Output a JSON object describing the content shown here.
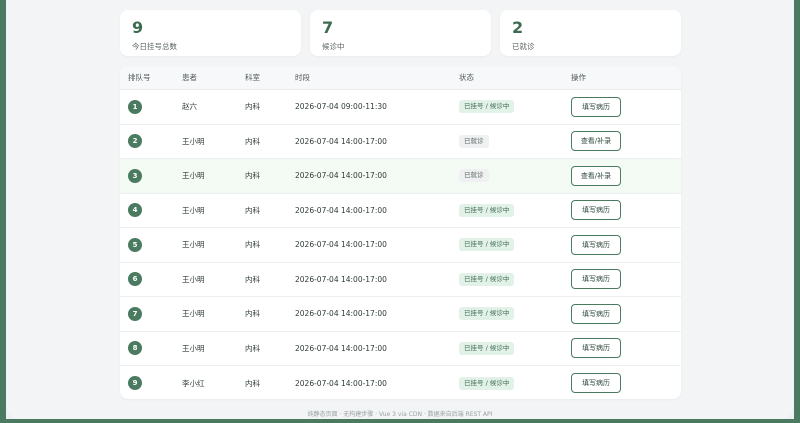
{
  "stats": [
    {
      "value": "9",
      "label": "今日挂号总数"
    },
    {
      "value": "7",
      "label": "候诊中"
    },
    {
      "value": "2",
      "label": "已就诊"
    }
  ],
  "table": {
    "headers": [
      "排队号",
      "患者",
      "科室",
      "时段",
      "状态",
      "操作"
    ],
    "rows": [
      {
        "queue": "1",
        "patient": "赵六",
        "dept": "内科",
        "time": "2026-07-04 09:00-11:30",
        "status": "已挂号 / 候诊中",
        "status_type": "waiting",
        "action": "填写病历"
      },
      {
        "queue": "2",
        "patient": "王小明",
        "dept": "内科",
        "time": "2026-07-04 14:00-17:00",
        "status": "已就诊",
        "status_type": "done",
        "action": "查看/补录"
      },
      {
        "queue": "3",
        "patient": "王小明",
        "dept": "内科",
        "time": "2026-07-04 14:00-17:00",
        "status": "已就诊",
        "status_type": "done",
        "action": "查看/补录"
      },
      {
        "queue": "4",
        "patient": "王小明",
        "dept": "内科",
        "time": "2026-07-04 14:00-17:00",
        "status": "已挂号 / 候诊中",
        "status_type": "waiting",
        "action": "填写病历"
      },
      {
        "queue": "5",
        "patient": "王小明",
        "dept": "内科",
        "time": "2026-07-04 14:00-17:00",
        "status": "已挂号 / 候诊中",
        "status_type": "waiting",
        "action": "填写病历"
      },
      {
        "queue": "6",
        "patient": "王小明",
        "dept": "内科",
        "time": "2026-07-04 14:00-17:00",
        "status": "已挂号 / 候诊中",
        "status_type": "waiting",
        "action": "填写病历"
      },
      {
        "queue": "7",
        "patient": "王小明",
        "dept": "内科",
        "time": "2026-07-04 14:00-17:00",
        "status": "已挂号 / 候诊中",
        "status_type": "waiting",
        "action": "填写病历"
      },
      {
        "queue": "8",
        "patient": "王小明",
        "dept": "内科",
        "time": "2026-07-04 14:00-17:00",
        "status": "已挂号 / 候诊中",
        "status_type": "waiting",
        "action": "填写病历"
      },
      {
        "queue": "9",
        "patient": "李小红",
        "dept": "内科",
        "time": "2026-07-04 14:00-17:00",
        "status": "已挂号 / 候诊中",
        "status_type": "waiting",
        "action": "填写病历"
      }
    ]
  },
  "footer": "纯静态页面 · 无构建步骤 · Vue 3 via CDN · 数据来自后端 REST API",
  "colors": {
    "accent": "#4a7b61",
    "waiting_bg": "#e3f2e8",
    "done_bg": "#eef0f1"
  }
}
